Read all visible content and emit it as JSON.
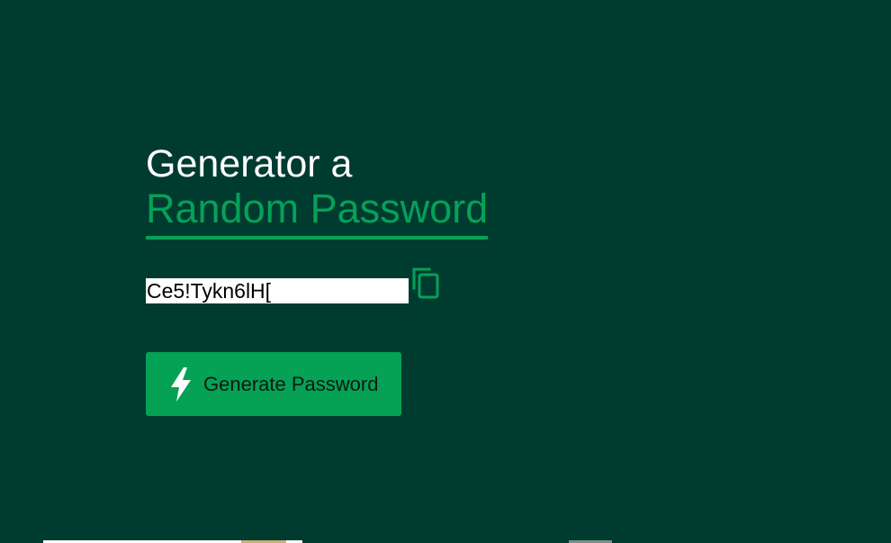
{
  "header": {
    "title_line1": "Generator a",
    "title_line2": "Random Password"
  },
  "password": {
    "value": "Ce5!Tykn6lH["
  },
  "actions": {
    "copy_icon": "copy-icon",
    "generate_icon": "lightning-bolt-icon",
    "generate_label": "Generate Password"
  },
  "colors": {
    "background": "#003b30",
    "accent": "#05a157",
    "button": "#05a155"
  }
}
